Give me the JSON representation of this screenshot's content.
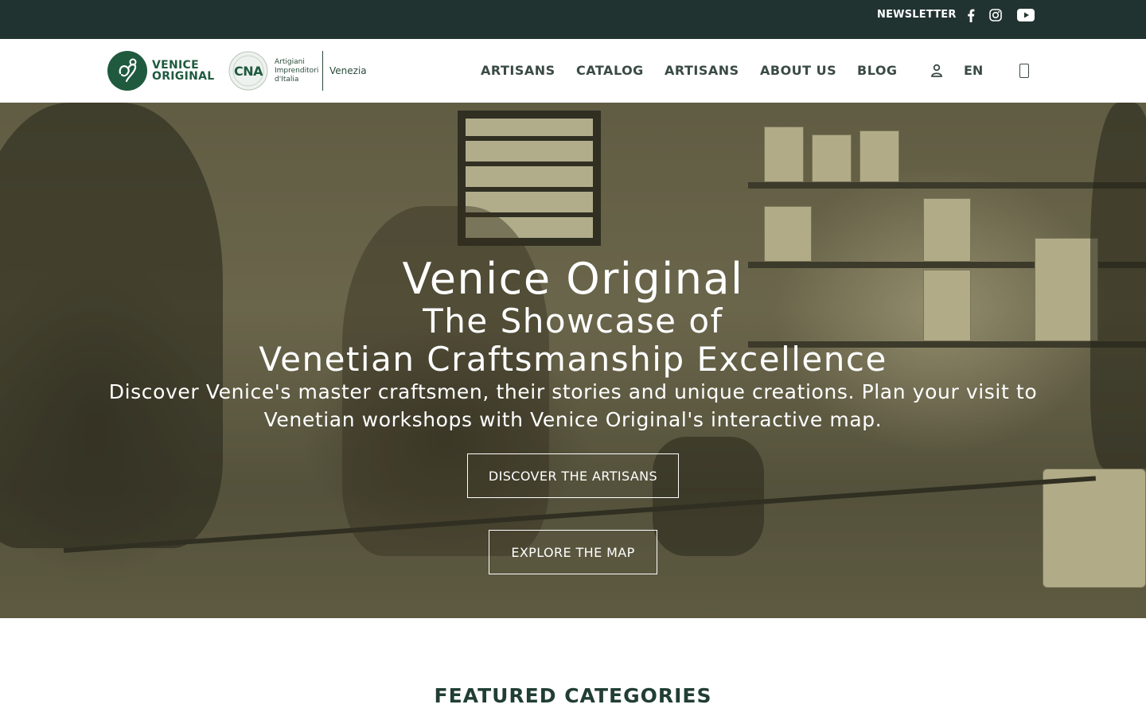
{
  "topbar": {
    "newsletter": "NEWSLETTER",
    "social_icons": [
      "facebook-icon",
      "instagram-icon",
      "youtube-icon"
    ]
  },
  "header": {
    "logo_text_line1": "VENICE",
    "logo_text_line2": "ORIGINAL",
    "cna_logo_text": "CNA",
    "cna_line1": "Artigiani",
    "cna_line2": "Imprenditori",
    "cna_line3": "d'Italia",
    "cna_city": "Venezia",
    "nav": [
      "ARTISANS",
      "CATALOG",
      "ARTISANS",
      "ABOUT US",
      "BLOG"
    ],
    "language": "EN",
    "user_icon": "user-icon",
    "cart_icon": "cart-icon"
  },
  "hero": {
    "title": "Venice Original",
    "subtitle_line1": "The Showcase of",
    "subtitle_line2": "Venetian Craftsmanship Excellence",
    "description": "Discover Venice's master craftsmen, their stories and unique creations. Plan your visit to Venetian workshops with Venice Original's interactive map.",
    "button_primary": "DISCOVER THE ARTISANS",
    "button_secondary": "EXPLORE THE MAP"
  },
  "main": {
    "section_title": "FEATURED CATEGORIES"
  },
  "colors": {
    "topbar_bg": "#213330",
    "brand_green": "#1f5a3f",
    "nav_text": "#3a4a45",
    "hero_tone": "#6d684e"
  }
}
